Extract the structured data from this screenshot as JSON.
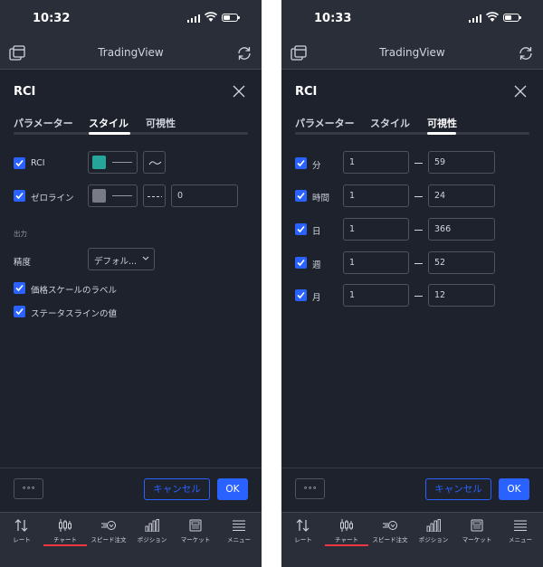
{
  "app": {
    "title": "TradingView"
  },
  "status_left": {
    "time": "10:32"
  },
  "status_right": {
    "time": "10:33"
  },
  "dialog": {
    "title": "RCI",
    "tabs": [
      "パラメーター",
      "スタイル",
      "可視性"
    ]
  },
  "style_tab": {
    "rows": [
      {
        "label": "RCI",
        "color": "#26a69a",
        "checked": true
      },
      {
        "label": "ゼロライン",
        "color": "#787b86",
        "checked": true,
        "value": "0"
      }
    ],
    "section_label": "出力",
    "precision": {
      "label": "精度",
      "value": "デフォル..."
    },
    "checkboxes": [
      "価格スケールのラベル",
      "ステータスラインの値"
    ]
  },
  "visibility_tab": {
    "rows": [
      {
        "label": "分",
        "from": "1",
        "to": "59"
      },
      {
        "label": "時間",
        "from": "1",
        "to": "24"
      },
      {
        "label": "日",
        "from": "1",
        "to": "366"
      },
      {
        "label": "週",
        "from": "1",
        "to": "52"
      },
      {
        "label": "月",
        "from": "1",
        "to": "12"
      }
    ]
  },
  "footer": {
    "more": "∘∘∘",
    "cancel": "キャンセル",
    "ok": "OK"
  },
  "tabbar": {
    "items": [
      "レート",
      "チャート",
      "スピード注文",
      "ポジション",
      "マーケット",
      "メニュー"
    ],
    "active": "チャート"
  },
  "colors": {
    "accent": "#2962ff",
    "active_underline": "#f23645",
    "background": "#1e222d"
  }
}
